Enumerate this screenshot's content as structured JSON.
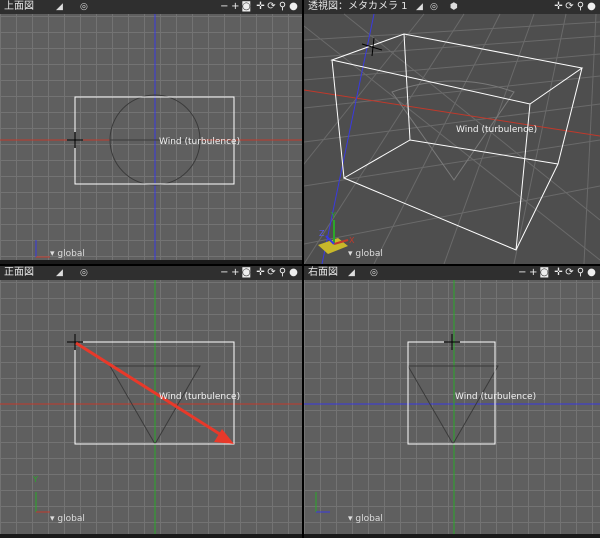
{
  "viewports": {
    "top": {
      "title": "上面図",
      "global": "global",
      "object_label": "Wind (turbulence)"
    },
    "perspective": {
      "title": "透視図：メタカメラ 1",
      "global": "global",
      "object_label": "Wind (turbulence)"
    },
    "front": {
      "title": "正面図",
      "global": "global",
      "object_label": "Wind (turbulence)"
    },
    "right": {
      "title": "右面図",
      "global": "global",
      "object_label": "Wind (turbulence)"
    }
  },
  "toolbar_icons": [
    "target-icon",
    "minus-icon",
    "plus-icon",
    "camera-icon",
    "move-icon",
    "rotate-icon",
    "zoom-icon",
    "sphere-icon"
  ],
  "colors": {
    "grid_line": "#737373",
    "viewport_bg": "#5f5f5f",
    "x_axis": "#c0392b",
    "y_axis": "#2aa82a",
    "z_axis": "#3a3ae0",
    "selection_box": "#ffffff",
    "arrow": "#e8392a"
  },
  "axis_labels": {
    "x": "X",
    "y": "Y",
    "z": "Z"
  }
}
